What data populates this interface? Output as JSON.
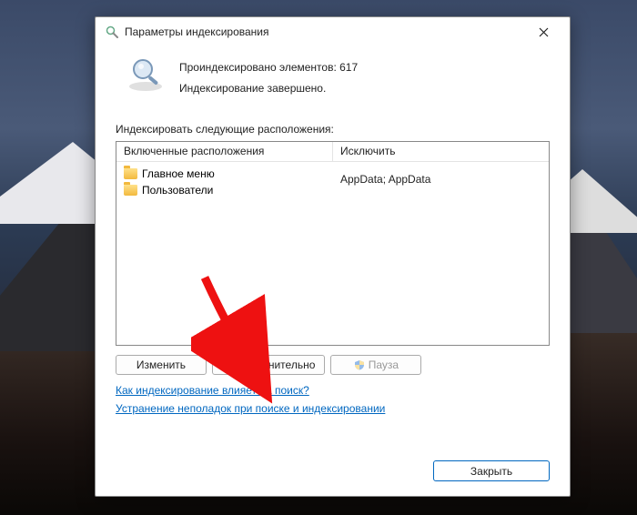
{
  "window": {
    "title": "Параметры индексирования"
  },
  "status": {
    "indexed_count_label": "Проиндексировано элементов: 617",
    "progress_label": "Индексирование завершено."
  },
  "section": {
    "label": "Индексировать следующие расположения:"
  },
  "columns": {
    "included": "Включенные расположения",
    "excluded": "Исключить"
  },
  "locations": [
    {
      "name": "Главное меню",
      "exclude": ""
    },
    {
      "name": "Пользователи",
      "exclude": "AppData; AppData"
    }
  ],
  "buttons": {
    "modify": "Изменить",
    "advanced": "Дополнительно",
    "pause": "Пауза",
    "close": "Закрыть"
  },
  "links": {
    "how_affects": "Как индексирование влияет на поиск?",
    "troubleshoot": "Устранение неполадок при поиске и индексировании"
  }
}
